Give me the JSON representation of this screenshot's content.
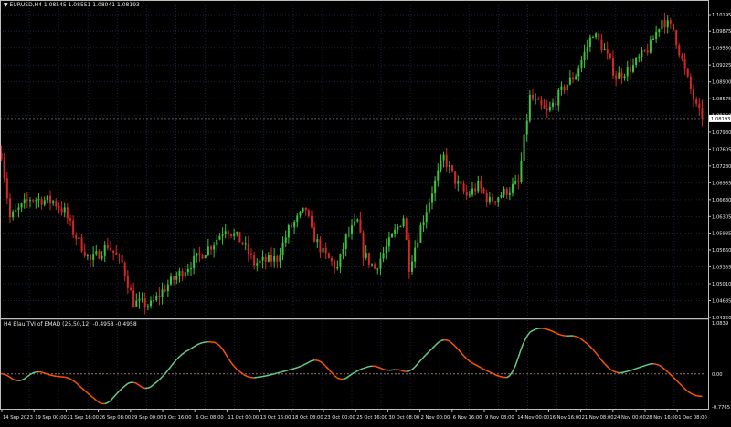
{
  "window": {
    "symbol_label": "EURUSD,H4  1.08545  1.08551  1.08041  1.08193",
    "indicator_label": "H4 Blau TVI of EMAD (25,50,12) -0.4958 -0.4958",
    "current_price": "1.08193"
  },
  "colors": {
    "background": "#000000",
    "grid": "#16243d",
    "bull_candle": "#3cc23c",
    "bear_candle": "#d92525",
    "indicator_up": "#66cc88",
    "indicator_down": "#ff5500",
    "axis_text": "#e6e6e6",
    "zero_line": "#a07070"
  },
  "chart_data": [
    {
      "type": "candlestick",
      "title": "EURUSD,H4",
      "price_scale": [
        "1.10195",
        "1.09875",
        "1.09550",
        "1.09225",
        "1.08900",
        "1.08575",
        "1.08250",
        "1.07930",
        "1.07605",
        "1.07280",
        "1.06955",
        "1.06630",
        "1.06305",
        "1.05985",
        "1.05660",
        "1.05335",
        "1.05010",
        "1.04685",
        "1.04360"
      ],
      "ylim": [
        1.0436,
        1.10355
      ],
      "current_price": 1.08193,
      "approx_close_path": [
        [
          0,
          1.0752
        ],
        [
          3,
          1.0628
        ],
        [
          10,
          1.0665
        ],
        [
          18,
          1.066
        ],
        [
          22,
          1.064
        ],
        [
          25,
          1.06
        ],
        [
          31,
          1.0545
        ],
        [
          37,
          1.0575
        ],
        [
          42,
          1.054
        ],
        [
          46,
          1.0465
        ],
        [
          52,
          1.046
        ],
        [
          58,
          1.05
        ],
        [
          66,
          1.054
        ],
        [
          74,
          1.058
        ],
        [
          78,
          1.061
        ],
        [
          84,
          1.058
        ],
        [
          88,
          1.054
        ],
        [
          96,
          1.055
        ],
        [
          100,
          1.0605
        ],
        [
          106,
          1.0645
        ],
        [
          108,
          1.06
        ],
        [
          112,
          1.056
        ],
        [
          117,
          1.053
        ],
        [
          120,
          1.059
        ],
        [
          124,
          1.062
        ],
        [
          126,
          1.056
        ],
        [
          130,
          1.053
        ],
        [
          136,
          1.059
        ],
        [
          140,
          1.063
        ],
        [
          142,
          1.0535
        ],
        [
          146,
          1.061
        ],
        [
          150,
          1.068
        ],
        [
          154,
          1.0745
        ],
        [
          158,
          1.07
        ],
        [
          162,
          1.067
        ],
        [
          166,
          1.069
        ],
        [
          170,
          1.066
        ],
        [
          176,
          1.068
        ],
        [
          180,
          1.0695
        ],
        [
          184,
          1.086
        ],
        [
          190,
          1.083
        ],
        [
          196,
          1.088
        ],
        [
          200,
          1.0905
        ],
        [
          206,
          1.0985
        ],
        [
          210,
          1.095
        ],
        [
          214,
          1.09
        ],
        [
          220,
          1.092
        ],
        [
          226,
          1.096
        ],
        [
          230,
          1.101
        ],
        [
          234,
          1.099
        ],
        [
          238,
          1.091
        ],
        [
          242,
          1.084
        ],
        [
          244,
          1.0819
        ]
      ]
    },
    {
      "type": "line",
      "title": "H4 Blau TVI of EMAD (25,50,12)",
      "price_scale": [
        "1.0839",
        "0.00",
        "-0.7765"
      ],
      "ylim": [
        -0.7765,
        1.0839
      ],
      "series_value": -0.4958,
      "approx_path": [
        [
          0,
          0.05
        ],
        [
          6,
          -0.2
        ],
        [
          12,
          0.08
        ],
        [
          18,
          -0.05
        ],
        [
          24,
          -0.08
        ],
        [
          30,
          -0.42
        ],
        [
          36,
          -0.72
        ],
        [
          42,
          -0.3
        ],
        [
          46,
          -0.12
        ],
        [
          50,
          -0.38
        ],
        [
          56,
          -0.08
        ],
        [
          62,
          0.4
        ],
        [
          70,
          0.7
        ],
        [
          76,
          0.68
        ],
        [
          80,
          0.2
        ],
        [
          86,
          -0.1
        ],
        [
          92,
          -0.05
        ],
        [
          98,
          0.05
        ],
        [
          104,
          0.15
        ],
        [
          110,
          0.35
        ],
        [
          114,
          0.1
        ],
        [
          118,
          -0.18
        ],
        [
          124,
          0.08
        ],
        [
          130,
          0.2
        ],
        [
          134,
          0.05
        ],
        [
          138,
          0.12
        ],
        [
          142,
          0.0
        ],
        [
          146,
          0.3
        ],
        [
          150,
          0.55
        ],
        [
          154,
          0.8
        ],
        [
          158,
          0.62
        ],
        [
          162,
          0.3
        ],
        [
          168,
          0.1
        ],
        [
          174,
          -0.08
        ],
        [
          178,
          -0.08
        ],
        [
          182,
          0.8
        ],
        [
          186,
          1.0
        ],
        [
          190,
          0.98
        ],
        [
          196,
          0.8
        ],
        [
          200,
          0.85
        ],
        [
          206,
          0.55
        ],
        [
          210,
          0.2
        ],
        [
          214,
          0.0
        ],
        [
          218,
          0.05
        ],
        [
          224,
          0.18
        ],
        [
          228,
          0.25
        ],
        [
          232,
          0.05
        ],
        [
          236,
          -0.2
        ],
        [
          240,
          -0.45
        ],
        [
          244,
          -0.5
        ]
      ]
    }
  ],
  "time_axis": {
    "labels": [
      "14 Sep 2023",
      "19 Sep 00:00",
      "21 Sep 16:00",
      "26 Sep 08:00",
      "29 Sep 00:00",
      "3 Oct 16:00",
      "6 Oct 08:00",
      "11 Oct 00:00",
      "13 Oct 16:00",
      "18 Oct 08:00",
      "23 Oct 00:00",
      "25 Oct 16:00",
      "30 Oct 08:00",
      "2 Nov 00:00",
      "6 Nov 16:00",
      "9 Nov 08:00",
      "14 Nov 00:00",
      "16 Nov 16:00",
      "21 Nov 08:00",
      "24 Nov 00:00",
      "28 Nov 16:00",
      "1 Dec 08:00"
    ]
  }
}
